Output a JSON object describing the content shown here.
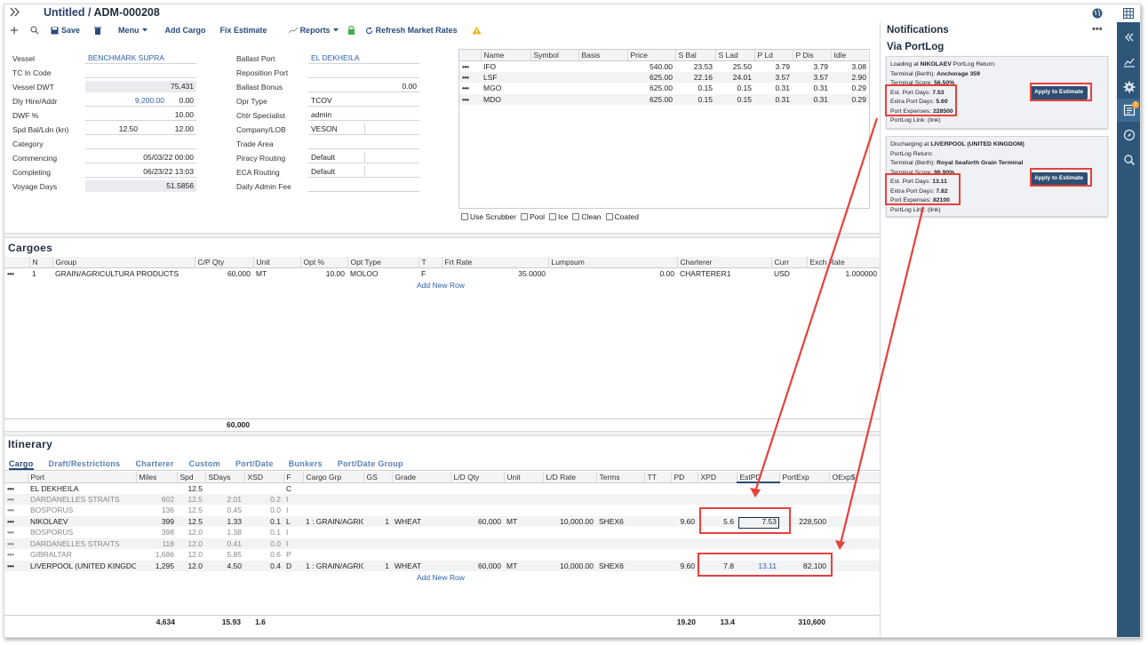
{
  "header": {
    "title_untitled": "Untitled /",
    "title_id": "ADM-000208"
  },
  "toolbar": {
    "save": "Save",
    "menu": "Menu",
    "add_cargo": "Add Cargo",
    "fix_estimate": "Fix Estimate",
    "reports": "Reports",
    "refresh": "Refresh Market Rates"
  },
  "form_left": {
    "vessel_label": "Vessel",
    "vessel_value": "BENCHMARK SUPRA",
    "tc_label": "TC In Code",
    "dwt_label": "Vessel DWT",
    "dwt_value": "75,431",
    "hire_label": "Dly Hire/Addr",
    "hire_value": "9,200.00",
    "addr_value": "0.00",
    "dwf_label": "DWF %",
    "dwf_value": "10.00",
    "spd_label": "Spd Bal/Ldn (kn)",
    "spd_bal": "12.50",
    "spd_ldn": "12.00",
    "category_label": "Category",
    "commencing_label": "Commencing",
    "commencing_value": "05/03/22 00:00",
    "completing_label": "Completing",
    "completing_value": "06/23/22 13:03",
    "voyage_days_label": "Voyage Days",
    "voyage_days_value": "51.5856"
  },
  "form_mid": {
    "ballast_port_label": "Ballast Port",
    "ballast_port_value": "EL DEKHEILA",
    "reposition_label": "Reposition Port",
    "ballast_bonus_label": "Ballast Bonus",
    "ballast_bonus_value": "0.00",
    "opr_type_label": "Opr Type",
    "opr_type_value": "TCOV",
    "chtr_label": "Chtr Specialist",
    "chtr_value": "admin",
    "company_label": "Company/LOB",
    "company_value": "VESON",
    "trade_area_label": "Trade Area",
    "piracy_label": "Piracy Routing",
    "piracy_value": "Default",
    "eca_label": "ECA Routing",
    "eca_value": "Default",
    "admin_fee_label": "Daily Admin Fee"
  },
  "bunkers": {
    "headers": [
      "Name",
      "Symbol",
      "Basis",
      "Price",
      "S Bal",
      "S Lad",
      "P Ld",
      "P Dis",
      "Idle"
    ],
    "rows": [
      [
        "IFO",
        "",
        "",
        "540.00",
        "23.53",
        "25.50",
        "3.79",
        "3.79",
        "3.08"
      ],
      [
        "LSF",
        "",
        "",
        "625.00",
        "22.16",
        "24.01",
        "3.57",
        "3.57",
        "2.90"
      ],
      [
        "MGO",
        "",
        "",
        "625.00",
        "0.15",
        "0.15",
        "0.31",
        "0.31",
        "0.29"
      ],
      [
        "MDO",
        "",
        "",
        "625.00",
        "0.15",
        "0.15",
        "0.31",
        "0.31",
        "0.29"
      ]
    ],
    "options": [
      "Use Scrubber",
      "Pool",
      "Ice",
      "Clean",
      "Coated"
    ]
  },
  "cargoes": {
    "title": "Cargoes",
    "headers": [
      "",
      "N",
      "Group",
      "C/P Qty",
      "Unit",
      "Opt %",
      "Opt Type",
      "T",
      "Frt Rate",
      "Lumpsum",
      "Charterer",
      "Curr",
      "Exch Rate"
    ],
    "rows": [
      [
        "•••",
        "1",
        "GRAIN/AGRICULTURA PRODUCTS",
        "60,000",
        "MT",
        "10.00",
        "MOLOO",
        "F",
        "35.0000",
        "0.00",
        "CHARTERER1",
        "USD",
        "1.000000"
      ]
    ],
    "add_row": "Add New Row",
    "total_qty": "60,000"
  },
  "itinerary": {
    "title": "Itinerary",
    "tabs": [
      "Cargo",
      "Draft/Restrictions",
      "Charterer",
      "Custom",
      "Port/Date",
      "Bunkers",
      "Port/Date Group"
    ],
    "headers": [
      "",
      "Port",
      "Miles",
      "Spd",
      "SDays",
      "XSD",
      "F",
      "Cargo Grp",
      "GS",
      "Grade",
      "L/D Qty",
      "Unit",
      "L/D Rate",
      "Terms",
      "TT",
      "PD",
      "XPD",
      "EstPD",
      "PortExp",
      "OExp$"
    ],
    "rows": [
      [
        "•••",
        "EL DEKHEILA",
        "",
        "12.5",
        "",
        "",
        "C",
        "",
        "",
        "",
        "",
        "",
        "",
        "",
        "",
        "",
        "",
        "",
        "",
        ""
      ],
      [
        "•••",
        "DARDANELLES STRAITS",
        "602",
        "12.5",
        "2.01",
        "0.2",
        "I",
        "",
        "",
        "",
        "",
        "",
        "",
        "",
        "",
        "",
        "",
        "",
        "",
        ""
      ],
      [
        "•••",
        "BOSPORUS",
        "136",
        "12.5",
        "0.45",
        "0.0",
        "I",
        "",
        "",
        "",
        "",
        "",
        "",
        "",
        "",
        "",
        "",
        "",
        "",
        ""
      ],
      [
        "•••",
        "NIKOLAEV",
        "399",
        "12.5",
        "1.33",
        "0.1",
        "L",
        "1 : GRAIN/AGRIC",
        "1",
        "WHEAT",
        "60,000",
        "MT",
        "10,000.00",
        "SHEX6",
        "",
        "9.60",
        "5.6",
        "7.53",
        "228,500",
        ""
      ],
      [
        "•••",
        "BOSPORUS",
        "398",
        "12.0",
        "1.38",
        "0.1",
        "I",
        "",
        "",
        "",
        "",
        "",
        "",
        "",
        "",
        "",
        "",
        "",
        "",
        ""
      ],
      [
        "•••",
        "DARDANELLES STRAITS",
        "118",
        "12.0",
        "0.41",
        "0.0",
        "I",
        "",
        "",
        "",
        "",
        "",
        "",
        "",
        "",
        "",
        "",
        "",
        "",
        ""
      ],
      [
        "•••",
        "GIBRALTAR",
        "1,686",
        "12.0",
        "5.85",
        "0.6",
        "P",
        "",
        "",
        "",
        "",
        "",
        "",
        "",
        "",
        "",
        "",
        "",
        "",
        ""
      ],
      [
        "•••",
        "LIVERPOOL (UNITED KINGDOI",
        "1,295",
        "12.0",
        "4.50",
        "0.4",
        "D",
        "1 : GRAIN/AGRIC",
        "1",
        "WHEAT",
        "60,000",
        "MT",
        "10,000.00",
        "SHEX6",
        "",
        "9.60",
        "7.8",
        "13.11",
        "82,100",
        ""
      ]
    ],
    "add_row": "Add New Row",
    "totals": {
      "miles": "4,634",
      "sdays": "15.93",
      "xsd": "1.6",
      "pd": "19.20",
      "xpd": "13.4",
      "portexp": "310,600"
    }
  },
  "notifications": {
    "title": "Notifications",
    "subtitle": "Via PortLog",
    "card1": {
      "line1_a": "Loading at ",
      "line1_port": "NIKOLAEV",
      "line1_b": " PortLog Return:",
      "terminal_label": "Terminal (Berth): ",
      "terminal": "Anchorage 359",
      "score_label": "Terminal Score: ",
      "score": "56.50%",
      "est_label": "Est. Port Days: ",
      "est": "7.53",
      "extra_label": "Extra Port Days: ",
      "extra": "5.60",
      "exp_label": "Port Expenses: ",
      "exp": "228500",
      "link": "PortLog Link: (link)",
      "apply": "Apply to Estimate"
    },
    "card2": {
      "line1_a": "Discharging at ",
      "line1_port": "LIVERPOOL (UNITED KINGDOM)",
      "line2": "PortLog Return:",
      "terminal_label": "Terminal (Berth): ",
      "terminal": "Royal Seaforth Grain Terminal",
      "score_label": "Terminal Score: ",
      "score": "98.90%",
      "est_label": "Est. Port Days: ",
      "est": "13.11",
      "extra_label": "Extra Port Days: ",
      "extra": "7.82",
      "exp_label": "Port Expenses: ",
      "exp": "82100",
      "link": "PortLog Link: (link)",
      "apply": "Apply to Estimate"
    }
  },
  "colors": {
    "rail": "#2e5679",
    "accent": "#2a4a7b",
    "highlight": "#e8403a",
    "apply_btn": "#2f4f72"
  }
}
